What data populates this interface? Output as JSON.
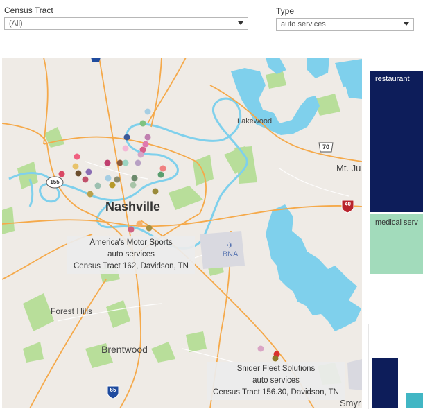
{
  "filters": {
    "census_tract": {
      "label": "Census Tract",
      "value": "(All)"
    },
    "type": {
      "label": "Type",
      "value": "auto services"
    }
  },
  "map": {
    "city_label": "Nashville",
    "place_labels": {
      "lakewood": "Lakewood",
      "mt_juliet": "Mt. Ju",
      "forest_hills": "Forest Hills",
      "brentwood": "Brentwood",
      "smyrna": "Smyr",
      "airport": "BNA"
    },
    "shields": {
      "i40": "40",
      "i65": "65",
      "sr155": "155",
      "us70": "70"
    },
    "tooltips": [
      {
        "name": "America's Motor Sports",
        "type": "auto services",
        "tract": "Census Tract 162, Davidson, TN"
      },
      {
        "name": "Snider Fleet Solutions",
        "type": "auto services",
        "tract": "Census Tract 156.30, Davidson, TN"
      }
    ],
    "water_color": "#7fd0ec",
    "park_color": "#b8de9a",
    "road_color": "#f5a94a"
  },
  "treemap": {
    "tiles": [
      {
        "label": "restaurant",
        "color": "#0d1d5a"
      },
      {
        "label": "medical serv",
        "color": "#a2dbbb"
      }
    ]
  },
  "bar_colors": {
    "navy": "#0d1d5a",
    "teal": "#41b6c4"
  }
}
